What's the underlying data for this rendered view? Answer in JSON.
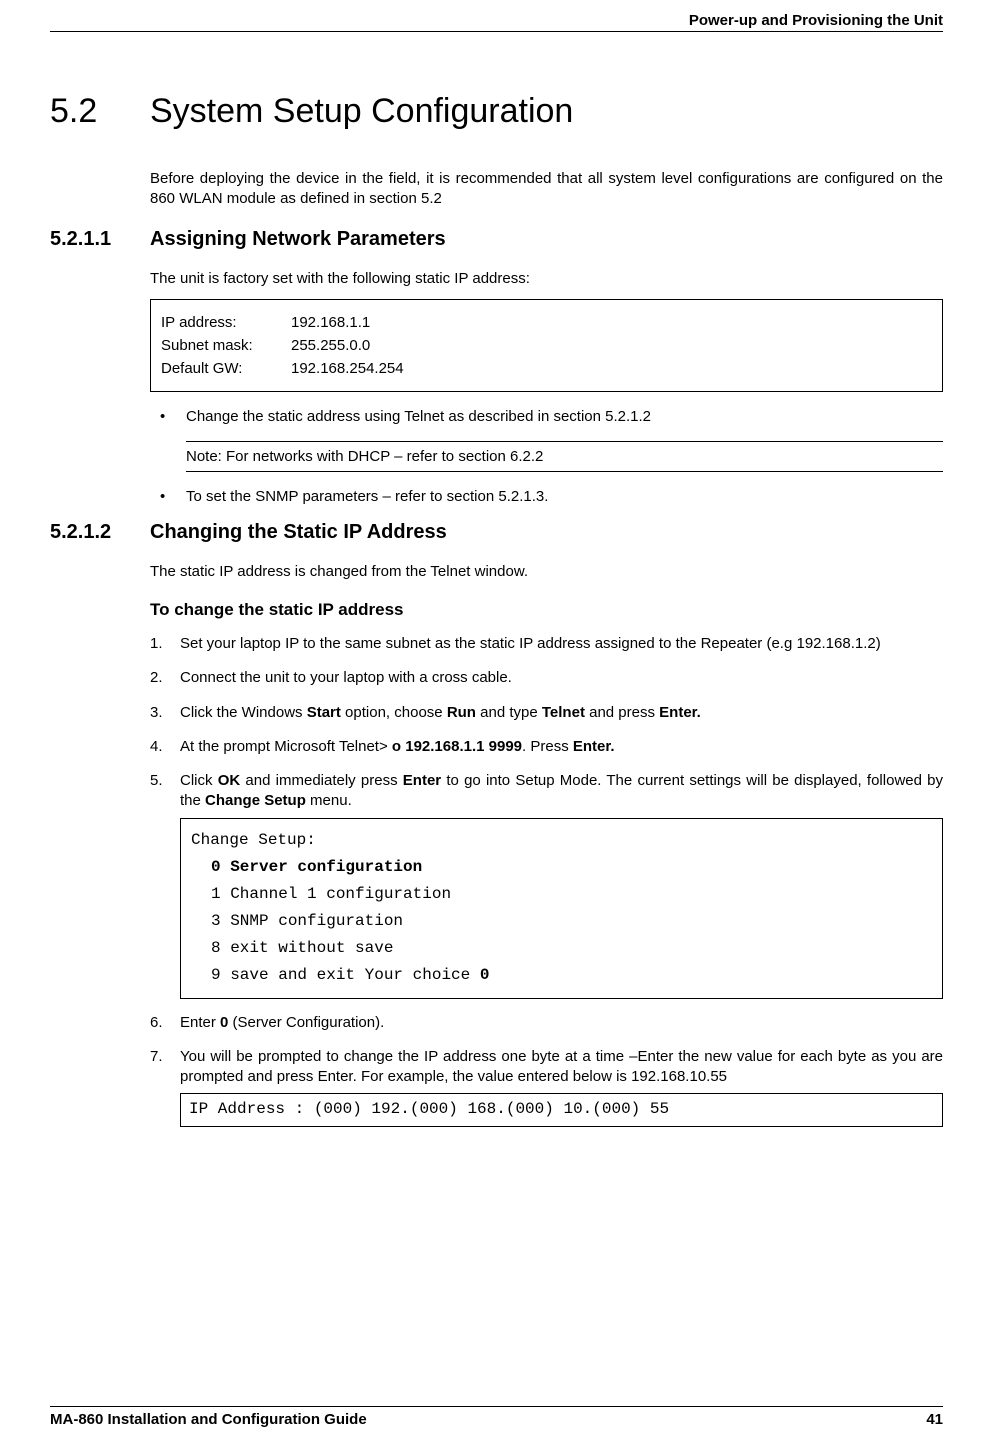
{
  "header": {
    "chapter": "Power-up and Provisioning the Unit"
  },
  "section": {
    "num": "5.2",
    "title": "System Setup Configuration",
    "intro": "Before deploying the device in the field, it is recommended that all system level configurations are configured on the 860 WLAN module as defined in section 5.2"
  },
  "sub1": {
    "num": "5.2.1.1",
    "title": "Assigning Network Parameters",
    "intro": "The unit is factory set with the following static IP address:",
    "ip": {
      "addr_label": "IP address:",
      "addr_val": "192.168.1.1",
      "mask_label": "Subnet mask:",
      "mask_val": "255.255.0.0",
      "gw_label": "Default GW:",
      "gw_val": "192.168.254.254"
    },
    "bullet1": "Change the static address using Telnet as described in section  5.2.1.2",
    "note": "Note: For networks with DHCP – refer to section 6.2.2",
    "bullet2": "To set the SNMP parameters – refer to section 5.2.1.3."
  },
  "sub2": {
    "num": "5.2.1.2",
    "title": "Changing the Static IP Address",
    "intro": "The static IP address is changed from the Telnet window.",
    "subhead": "To change the static IP address",
    "steps": {
      "s1": "Set your laptop IP to the same subnet as the static IP address assigned to the Repeater (e.g 192.168.1.2)",
      "s2": "Connect the unit to your laptop with a cross cable.",
      "s3a": "Click the Windows ",
      "s3b": "Start",
      "s3c": " option, choose ",
      "s3d": "Run",
      "s3e": " and type ",
      "s3f": "Telnet",
      "s3g": " and press ",
      "s3h": "Enter.",
      "s4a": "At the prompt Microsoft Telnet> ",
      "s4b": "o 192.168.1.1 9999",
      "s4c": ". Press ",
      "s4d": "Enter.",
      "s5a": "Click ",
      "s5b": "OK",
      "s5c": " and immediately press ",
      "s5d": "Enter",
      "s5e": " to go into Setup Mode. The current settings will be displayed, followed by the ",
      "s5f": "Change Setup",
      "s5g": " menu.",
      "s6a": "Enter ",
      "s6b": "0",
      "s6c": " (Server Configuration).",
      "s7": "You will be prompted to change the IP address one byte at a time –Enter the new value for each byte as you are prompted and press Enter. For example, the value entered below is 192.168.10.55"
    },
    "term": {
      "l0": "Change Setup:",
      "l1": "0 Server configuration",
      "l2": "1 Channel 1 configuration",
      "l3": "3 SNMP configuration",
      "l4": "8 exit without save",
      "l5a": "9 save and exit            Your choice ",
      "l5b": "0"
    },
    "ipline": "IP Address : (000) 192.(000) 168.(000) 10.(000) 55"
  },
  "footer": {
    "doc": "MA-860 Installation and Configuration Guide",
    "page": "41"
  }
}
